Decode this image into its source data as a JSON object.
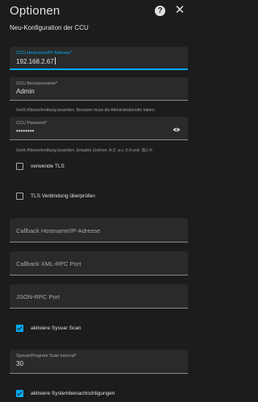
{
  "header": {
    "title": "Optionen",
    "help_icon": "help-circle-icon",
    "help_glyph": "?",
    "close_icon": "close-icon",
    "close_glyph": "✕"
  },
  "subtitle": "Neu-Konfiguration der CCU",
  "fields": {
    "host": {
      "label": "CCU Hostname/IP-Adresse*",
      "value": "192.168.2.67"
    },
    "username": {
      "label": "CCU Benutzername*",
      "value": "Admin",
      "helper": "Groß-/Kleinschreibung beachten. Benutzer muss die Administratorrolle haben."
    },
    "password": {
      "label": "CCU Passwort*",
      "value": "••••••••",
      "helper": "Groß-/Kleinschreibung beachten. Erlaubte Zeichen: A-Z, a-z, 0-9 und .!$():;#-"
    },
    "callback_host": {
      "placeholder": "Callback Hostname/IP-Adresse"
    },
    "callback_port": {
      "placeholder": "Callback XML-RPC Port"
    },
    "json_port": {
      "placeholder": "JSON-RPC Port"
    },
    "scan_interval": {
      "label": "Sysvar/Program Scan interval*",
      "value": "30"
    }
  },
  "checkboxes": {
    "tls": {
      "label": "verwende TLS",
      "checked": false
    },
    "verify_tls": {
      "label": "TLS Verbindung überprüfen",
      "checked": false
    },
    "sysvar_scan": {
      "label": "aktiviere Sysvar Scan",
      "checked": true
    },
    "system_notifications": {
      "label": "aktiviere Systembenachrichtigungen",
      "checked": true
    }
  },
  "colors": {
    "accent": "#03a9f4",
    "background": "#1c1c1c",
    "field_bg": "#2a2a2a"
  }
}
